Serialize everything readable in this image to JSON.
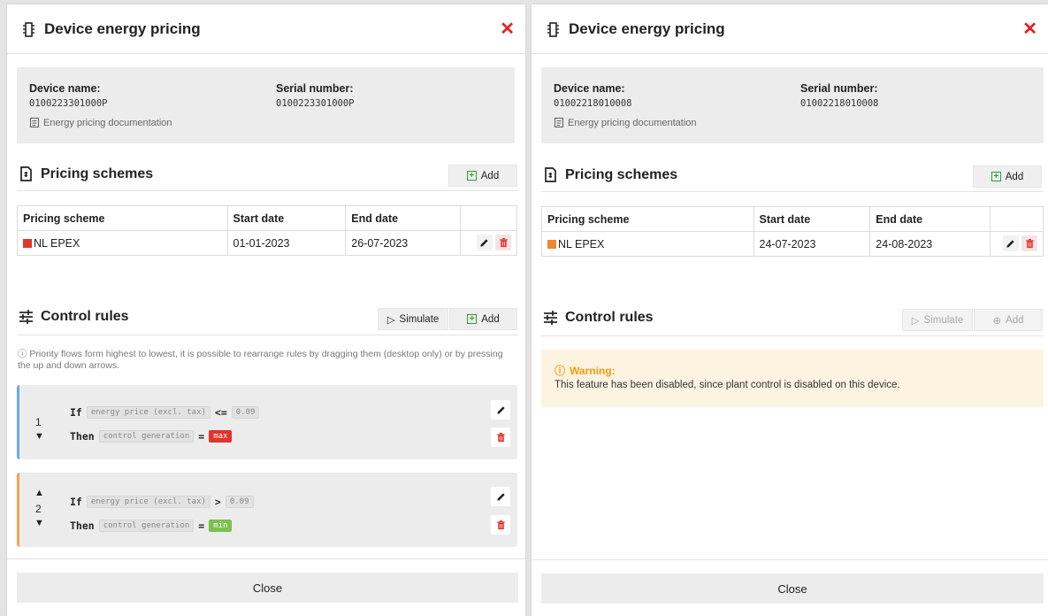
{
  "panels": [
    {
      "title": "Device energy pricing",
      "device_name_label": "Device name:",
      "device_name": "0100223301000P",
      "serial_label": "Serial number:",
      "serial": "0100223301000P",
      "doc_link": "Energy pricing documentation",
      "pricing_title": "Pricing schemes",
      "add_label": "Add",
      "table": {
        "headers": [
          "Pricing scheme",
          "Start date",
          "End date"
        ],
        "rows": [
          {
            "scheme": "NL EPEX",
            "start": "01-01-2023",
            "end": "26-07-2023",
            "color": "#e3342b"
          }
        ]
      },
      "control_title": "Control rules",
      "simulate_label": "Simulate",
      "control_add_label": "Add",
      "note": "ⓘ Priority flows form highest to lowest, it is possible to rearrange rules by dragging them (desktop only) or by pressing the up and down arrows.",
      "rules": [
        {
          "index": "1",
          "bar_color": "#6aa9f2",
          "if_kw": "If",
          "if_var": "energy price (excl. tax)",
          "if_op": "<=",
          "if_val": "0.09",
          "then_kw": "Then",
          "then_var": "control generation",
          "then_op": "=",
          "then_val": "max",
          "then_color": "red"
        },
        {
          "index": "2",
          "bar_color": "#f2a44f",
          "if_kw": "If",
          "if_var": "energy price (excl. tax)",
          "if_op": ">",
          "if_val": "0.09",
          "then_kw": "Then",
          "then_var": "control generation",
          "then_op": "=",
          "then_val": "min",
          "then_color": "green"
        }
      ],
      "close_label": "Close"
    },
    {
      "title": "Device energy pricing",
      "device_name_label": "Device name:",
      "device_name": "01002218010008",
      "serial_label": "Serial number:",
      "serial": "01002218010008",
      "doc_link": "Energy pricing documentation",
      "pricing_title": "Pricing schemes",
      "add_label": "Add",
      "table": {
        "headers": [
          "Pricing scheme",
          "Start date",
          "End date"
        ],
        "rows": [
          {
            "scheme": "NL EPEX",
            "start": "24-07-2023",
            "end": "24-08-2023",
            "color": "#f0862d"
          }
        ]
      },
      "control_title": "Control rules",
      "simulate_label": "Simulate",
      "control_add_label": "Add",
      "warning_title": "Warning:",
      "warning_text": "This feature has been disabled, since plant control is disabled on this device.",
      "close_label": "Close"
    }
  ],
  "colors": {
    "close_x": "#e8201c",
    "warning": "#ef9b10",
    "add_plus": "#2f9e3c"
  }
}
